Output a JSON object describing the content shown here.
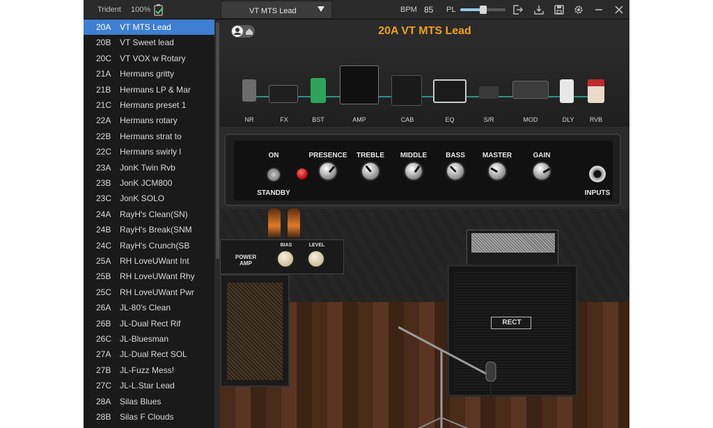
{
  "topbar": {
    "device_name": "Trident",
    "battery": "100%",
    "preset_select": "VT MTS Lead",
    "bpm_label": "BPM",
    "bpm_value": "85",
    "pl_label": "PL",
    "pl_level": 0.5
  },
  "presets": [
    {
      "num": "20A",
      "name": "VT MTS Lead",
      "selected": true
    },
    {
      "num": "20B",
      "name": "VT Sweet lead"
    },
    {
      "num": "20C",
      "name": "VT VOX w Rotary"
    },
    {
      "num": "21A",
      "name": "Hermans gritty"
    },
    {
      "num": "21B",
      "name": "Hermans LP & Mar"
    },
    {
      "num": "21C",
      "name": "Hermans preset 1"
    },
    {
      "num": "22A",
      "name": "Hermans rotary"
    },
    {
      "num": "22B",
      "name": "Hermans strat to"
    },
    {
      "num": "22C",
      "name": "Hermans swirly l"
    },
    {
      "num": "23A",
      "name": "JonK Twin Rvb"
    },
    {
      "num": "23B",
      "name": "JonK JCM800"
    },
    {
      "num": "23C",
      "name": "JonK SOLO"
    },
    {
      "num": "24A",
      "name": "RayH's Clean(SN)"
    },
    {
      "num": "24B",
      "name": "RayH's Break(SNM"
    },
    {
      "num": "24C",
      "name": "RayH's Crunch(SB"
    },
    {
      "num": "25A",
      "name": "RH LoveUWant Int"
    },
    {
      "num": "25B",
      "name": "RH LoveUWant Rhy"
    },
    {
      "num": "25C",
      "name": "RH LoveUWant Pwr"
    },
    {
      "num": "26A",
      "name": "JL-80's Clean"
    },
    {
      "num": "26B",
      "name": "JL-Dual Rect Rif"
    },
    {
      "num": "26C",
      "name": "JL-Bluesman"
    },
    {
      "num": "27A",
      "name": "JL-Dual Rect SOL"
    },
    {
      "num": "27B",
      "name": "JL-Fuzz Mess!"
    },
    {
      "num": "27C",
      "name": "JL-L.Star Lead"
    },
    {
      "num": "28A",
      "name": "Silas Blues"
    },
    {
      "num": "28B",
      "name": "Silas F Clouds"
    }
  ],
  "stage": {
    "title": "20A VT MTS Lead",
    "chain": [
      "NR",
      "FX",
      "BST",
      "AMP",
      "CAB",
      "EQ",
      "S/R",
      "MOD",
      "DLY",
      "RVB"
    ],
    "amp": {
      "on_label": "ON",
      "standby_label": "STANDBY",
      "inputs_label": "INPUTS",
      "knobs": [
        "PRESENCE",
        "TREBLE",
        "MIDDLE",
        "BASS",
        "MASTER",
        "GAIN"
      ]
    },
    "power_amp": {
      "label_line1": "POWER",
      "label_line2": "AMP",
      "bias_label": "BIAS",
      "level_label": "LEVEL"
    },
    "cab_badge": "RECT"
  },
  "colors": {
    "accent": "#f0a11a",
    "selected_row": "#3e7fd1",
    "signal": "#2fc3b0",
    "led": "#e01515"
  }
}
